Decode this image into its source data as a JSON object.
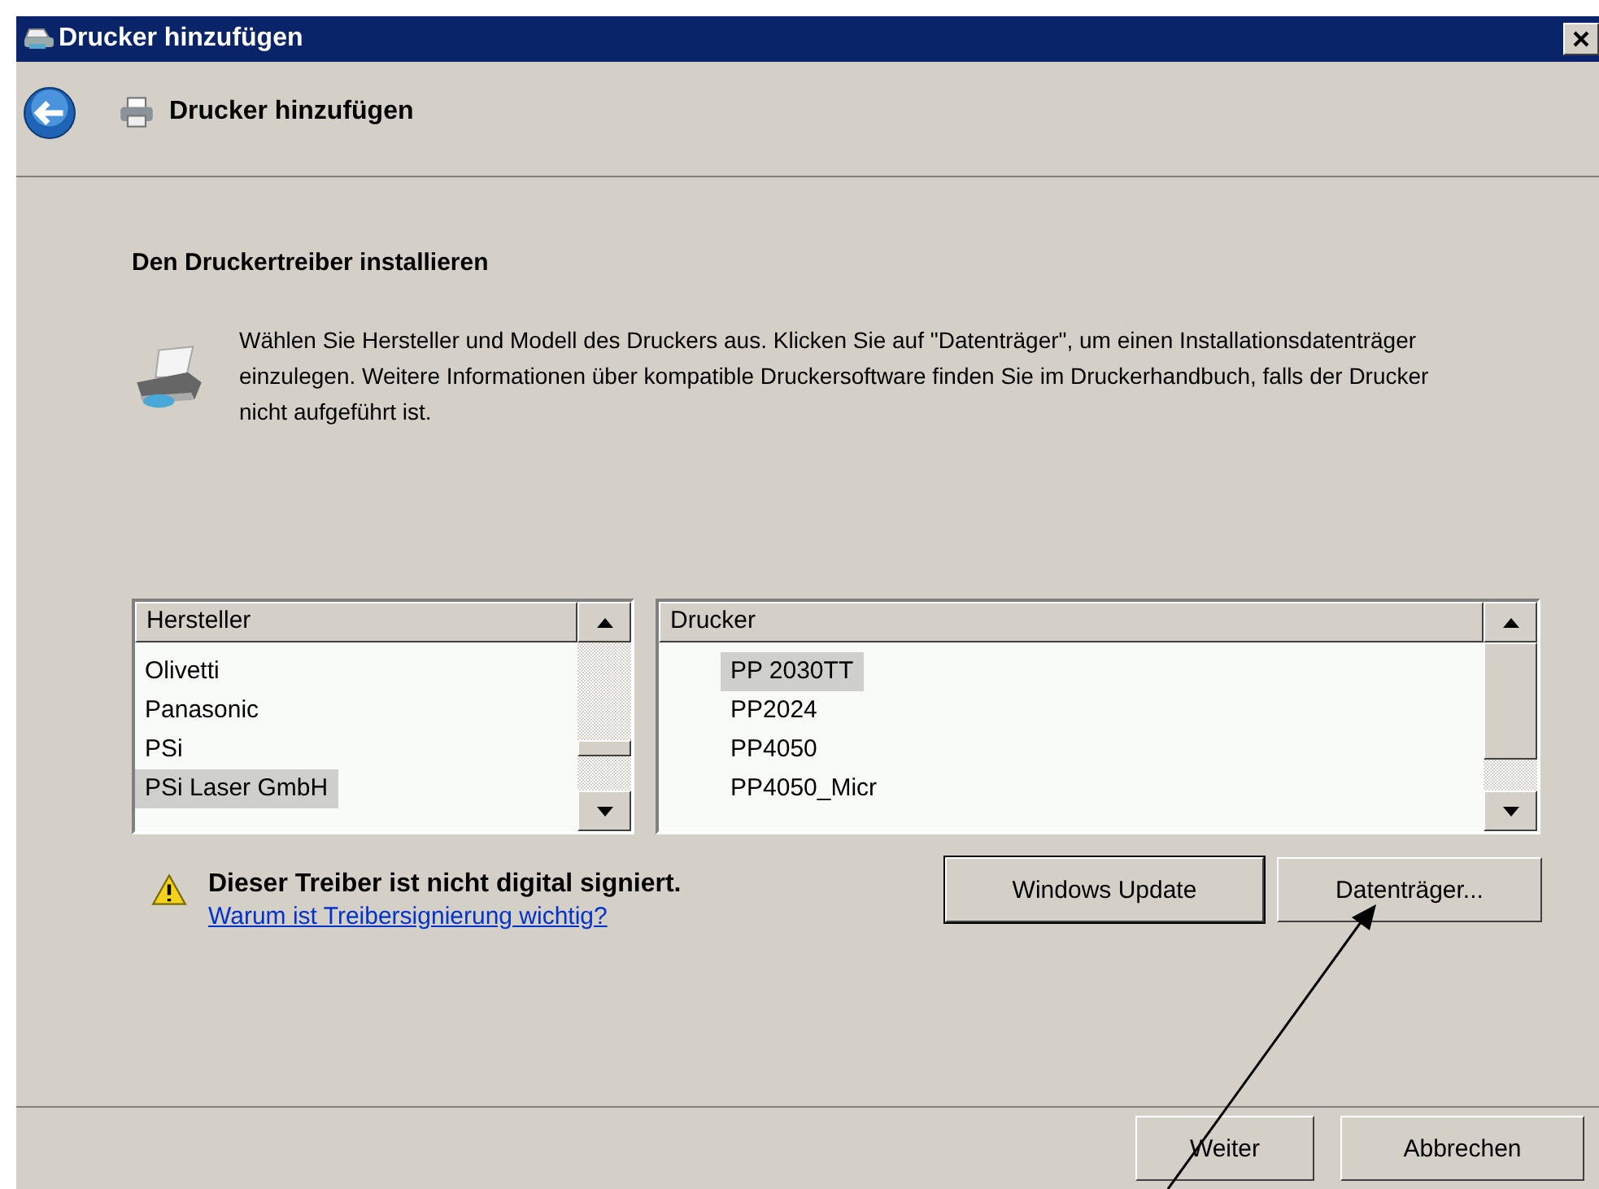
{
  "window": {
    "title": "Drucker hinzufügen"
  },
  "header": {
    "title": "Drucker hinzufügen"
  },
  "section_title": "Den Druckertreiber installieren",
  "description": "Wählen Sie Hersteller und Modell des Druckers aus. Klicken Sie auf \"Datenträger\", um einen Installationsdatenträger einzulegen. Weitere Informationen über kompatible Druckersoftware finden Sie im Druckerhandbuch, falls der Drucker nicht aufgeführt ist.",
  "manufacturers": {
    "heading": "Hersteller",
    "items": [
      {
        "label": "Olivetti",
        "selected": false
      },
      {
        "label": "Panasonic",
        "selected": false
      },
      {
        "label": "PSi",
        "selected": false
      },
      {
        "label": "PSi Laser GmbH",
        "selected": true
      }
    ]
  },
  "printers": {
    "heading": "Drucker",
    "items": [
      {
        "label": "PP 2030TT",
        "selected": true
      },
      {
        "label": "PP2024",
        "selected": false
      },
      {
        "label": "PP4050",
        "selected": false
      },
      {
        "label": "PP4050_Micr",
        "selected": false
      }
    ]
  },
  "warning": {
    "text": "Dieser Treiber ist nicht digital signiert.",
    "link": "Warum ist Treibersignierung wichtig?"
  },
  "action_buttons": [
    "Windows Update",
    "Datenträger..."
  ],
  "footer_buttons": [
    "Weiter",
    "Abbrechen"
  ]
}
